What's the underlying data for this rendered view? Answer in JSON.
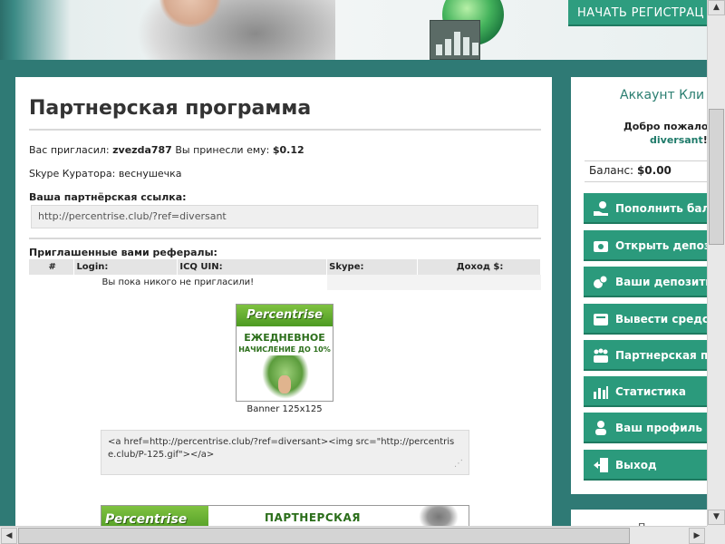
{
  "header": {
    "register_button": "НАЧАТЬ РЕГИСТРАЦ"
  },
  "main": {
    "title": "Партнерская программа",
    "invited_by_label": "Вас пригласил:",
    "invited_by_user": "zvezda787",
    "earned_label": "Вы принесли ему:",
    "earned_value": "$0.12",
    "skype_curator": "Skype Куратора: веснушечка",
    "ref_link_label": "Ваша партнёрская ссылка:",
    "ref_link": "http://percentrise.club/?ref=diversant",
    "referrals_label": "Приглашенные вами рефералы:",
    "table": {
      "headers": [
        "#",
        "Login:",
        "ICQ UIN:",
        "Skype:",
        "Доход $:"
      ],
      "empty_message": "Вы пока никого не пригласили!"
    },
    "banner_125": {
      "logo": "Percentrise",
      "line1": "ЕЖЕДНЕВНОЕ",
      "line2": "НАЧИСЛЕНИЕ ДО 10%",
      "caption": "Banner 125x125"
    },
    "banner_code": "<a href=http://percentrise.club/?ref=diversant><img src=\"http://percentrise.club/P-125.gif\"></a>",
    "banner_wide": {
      "logo": "Percentrise",
      "text": "ПАРТНЕРСКАЯ"
    }
  },
  "sidebar": {
    "title": "Аккаунт Кли",
    "welcome": "Добро пожалов",
    "username": "diversant",
    "username_suffix": "!",
    "balance_label": "Баланс:",
    "balance_value": "$0.00",
    "menu": [
      {
        "label": "Пополнить бала",
        "icon": "hand-money-icon"
      },
      {
        "label": "Открыть депози",
        "icon": "wallet-icon"
      },
      {
        "label": "Ваши депозиты",
        "icon": "coins-icon"
      },
      {
        "label": "Вывести средст",
        "icon": "withdraw-icon"
      },
      {
        "label": "Партнерская пр",
        "icon": "partners-icon"
      },
      {
        "label": "Статистика",
        "icon": "bar-chart-icon"
      },
      {
        "label": "Ваш профиль",
        "icon": "profile-icon"
      },
      {
        "label": "Выход",
        "icon": "exit-icon"
      }
    ],
    "bottom_text": "П"
  },
  "colors": {
    "accent": "#2b9a7c",
    "background": "#2f7a75"
  }
}
